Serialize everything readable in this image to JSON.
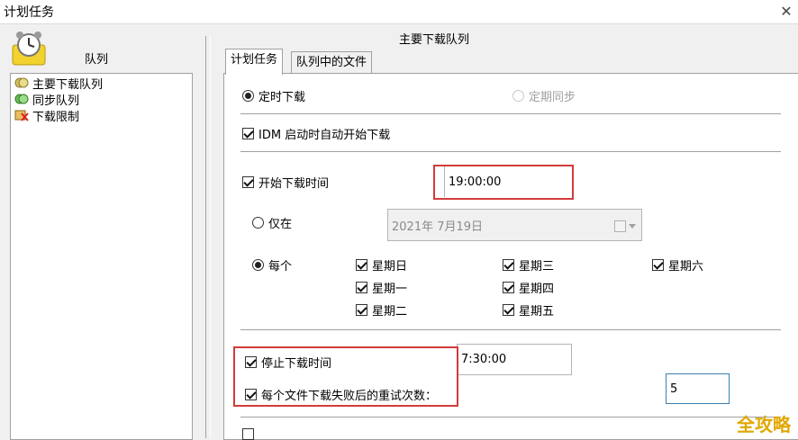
{
  "window": {
    "title": "计划任务"
  },
  "left_panel": {
    "header": "队列",
    "items": [
      {
        "label": "主要下载队列",
        "icon": "queue-main-icon"
      },
      {
        "label": "同步队列",
        "icon": "queue-sync-icon"
      },
      {
        "label": "下载限制",
        "icon": "download-limit-icon"
      }
    ]
  },
  "main": {
    "panel_title": "主要下载队列",
    "tabs": [
      {
        "label": "计划任务",
        "active": true
      },
      {
        "label": "队列中的文件",
        "active": false
      }
    ],
    "mode": {
      "timed_label": "定时下载",
      "periodic_label": "定期同步",
      "selected": "timed"
    },
    "auto_start": {
      "label": "IDM 启动时自动开始下载",
      "checked": true
    },
    "start_time": {
      "label": "开始下载时间",
      "checked": true,
      "value": "19:00:00"
    },
    "only_on": {
      "label": "仅在",
      "date": "2021年  7月19日"
    },
    "every": {
      "label": "每个",
      "days": [
        {
          "label": "星期日",
          "checked": true
        },
        {
          "label": "星期一",
          "checked": true
        },
        {
          "label": "星期二",
          "checked": true
        },
        {
          "label": "星期三",
          "checked": true
        },
        {
          "label": "星期四",
          "checked": true
        },
        {
          "label": "星期五",
          "checked": true
        },
        {
          "label": "星期六",
          "checked": true
        }
      ]
    },
    "stop_time": {
      "label": "停止下载时间",
      "checked": true,
      "value": "7:30:00"
    },
    "retry": {
      "label": "每个文件下载失败后的重试次数：",
      "checked": true,
      "value": "5"
    }
  },
  "watermark": "全攻略",
  "colors": {
    "highlight_box": "#d23b3b",
    "watermark": "#e0a800"
  }
}
